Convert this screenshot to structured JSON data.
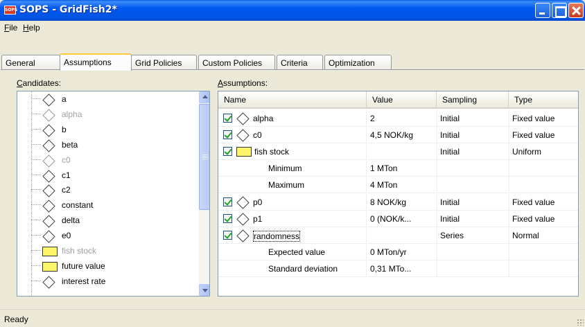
{
  "window": {
    "title": "SOPS - GridFish2*",
    "app_icon_text": "SOPS"
  },
  "menu": {
    "items": [
      {
        "label": "File",
        "accel": "F",
        "rest": "ile"
      },
      {
        "label": "Help",
        "accel": "H",
        "rest": "elp"
      }
    ]
  },
  "tabs": [
    {
      "label": "General",
      "active": false
    },
    {
      "label": "Assumptions",
      "active": true
    },
    {
      "label": "Grid Policies",
      "active": false
    },
    {
      "label": "Custom Policies",
      "active": false
    },
    {
      "label": "Criteria",
      "active": false
    },
    {
      "label": "Optimization",
      "active": false
    }
  ],
  "candidates": {
    "label_accel": "C",
    "label_rest": "andidates:",
    "items": [
      {
        "name": "a",
        "icon": "diamond-icon",
        "dim": false
      },
      {
        "name": "alpha",
        "icon": "diamond-icon",
        "dim": true
      },
      {
        "name": "b",
        "icon": "diamond-icon",
        "dim": false
      },
      {
        "name": "beta",
        "icon": "diamond-icon",
        "dim": false
      },
      {
        "name": "c0",
        "icon": "diamond-icon",
        "dim": true
      },
      {
        "name": "c1",
        "icon": "diamond-icon",
        "dim": false
      },
      {
        "name": "c2",
        "icon": "diamond-icon",
        "dim": false
      },
      {
        "name": "constant",
        "icon": "diamond-icon",
        "dim": false
      },
      {
        "name": "delta",
        "icon": "diamond-icon",
        "dim": false
      },
      {
        "name": "e0",
        "icon": "diamond-icon",
        "dim": false
      },
      {
        "name": "fish stock",
        "icon": "yellow-box-icon",
        "dim": true
      },
      {
        "name": "future value",
        "icon": "yellow-box-icon",
        "dim": false
      },
      {
        "name": "interest rate",
        "icon": "diamond-icon",
        "dim": false
      }
    ]
  },
  "assumptions": {
    "label_accel": "A",
    "label_rest": "ssumptions:",
    "columns": [
      "Name",
      "Value",
      "Sampling",
      "Type"
    ],
    "rows": [
      {
        "kind": "main",
        "checked": true,
        "icon": "diamond-icon",
        "name": "alpha",
        "value": "2",
        "sampling": "Initial",
        "type": "Fixed value"
      },
      {
        "kind": "main",
        "checked": true,
        "icon": "diamond-icon",
        "name": "c0",
        "value": "4,5 NOK/kg",
        "sampling": "Initial",
        "type": "Fixed value"
      },
      {
        "kind": "main",
        "checked": true,
        "icon": "yellow-box-icon",
        "name": "fish stock",
        "value": "",
        "sampling": "Initial",
        "type": "Uniform"
      },
      {
        "kind": "sub",
        "name": "Minimum",
        "value": "1 MTon",
        "sampling": "",
        "type": ""
      },
      {
        "kind": "sub",
        "name": "Maximum",
        "value": "4 MTon",
        "sampling": "",
        "type": ""
      },
      {
        "kind": "main",
        "checked": true,
        "icon": "diamond-icon",
        "name": "p0",
        "value": "8 NOK/kg",
        "sampling": "Initial",
        "type": "Fixed value"
      },
      {
        "kind": "main",
        "checked": true,
        "icon": "diamond-icon",
        "name": "p1",
        "value": "0 (NOK/k...",
        "sampling": "Initial",
        "type": "Fixed value"
      },
      {
        "kind": "main",
        "checked": true,
        "icon": "diamond-icon",
        "name": "randomness",
        "value": "",
        "sampling": "Series",
        "type": "Normal",
        "focused": true
      },
      {
        "kind": "sub",
        "name": "Expected value",
        "value": "0 MTon/yr",
        "sampling": "",
        "type": ""
      },
      {
        "kind": "sub",
        "name": "Standard deviation",
        "value": "0,31 MTo...",
        "sampling": "",
        "type": ""
      }
    ]
  },
  "status": {
    "text": "Ready"
  }
}
